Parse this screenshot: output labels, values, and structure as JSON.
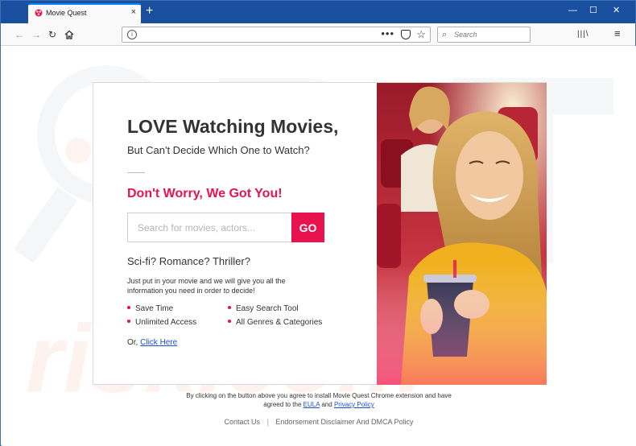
{
  "browser": {
    "tab_title": "Movie Quest",
    "tab_close": "×",
    "new_tab": "+",
    "window_controls": [
      "—",
      "☐",
      "✕"
    ],
    "search_placeholder": "Search",
    "url_value": ""
  },
  "hero": {
    "headline": "LOVE Watching Movies,",
    "subhead": "But Can't Decide Which One to Watch?",
    "tagline": "Don't Worry, We Got You!",
    "search_placeholder": "Search for movies, actors...",
    "go_label": "GO",
    "genres": "Sci-fi? Romance? Thriller?",
    "description": "Just put in your movie and we will give you all the information you need in order to decide!",
    "features_left": [
      "Save Time",
      "Unlimited Access"
    ],
    "features_right": [
      "Easy Search Tool",
      "All Genres & Categories"
    ],
    "or_label": "Or,",
    "click_here": "Click Here"
  },
  "legal": {
    "line1": "By clicking on the button above you agree to install Movie Quest Chrome extension and have",
    "line2_prefix": "agreed to the",
    "eula": "EULA",
    "and": "and",
    "privacy": "Privacy Policy"
  },
  "footer": {
    "contact": "Contact Us",
    "separator": "|",
    "disclaimer": "Endorsement Disclaimer And DMCA Policy"
  },
  "colors": {
    "accent": "#e8134e",
    "titlebar": "#1a4fa0",
    "link": "#1a4fd6"
  }
}
